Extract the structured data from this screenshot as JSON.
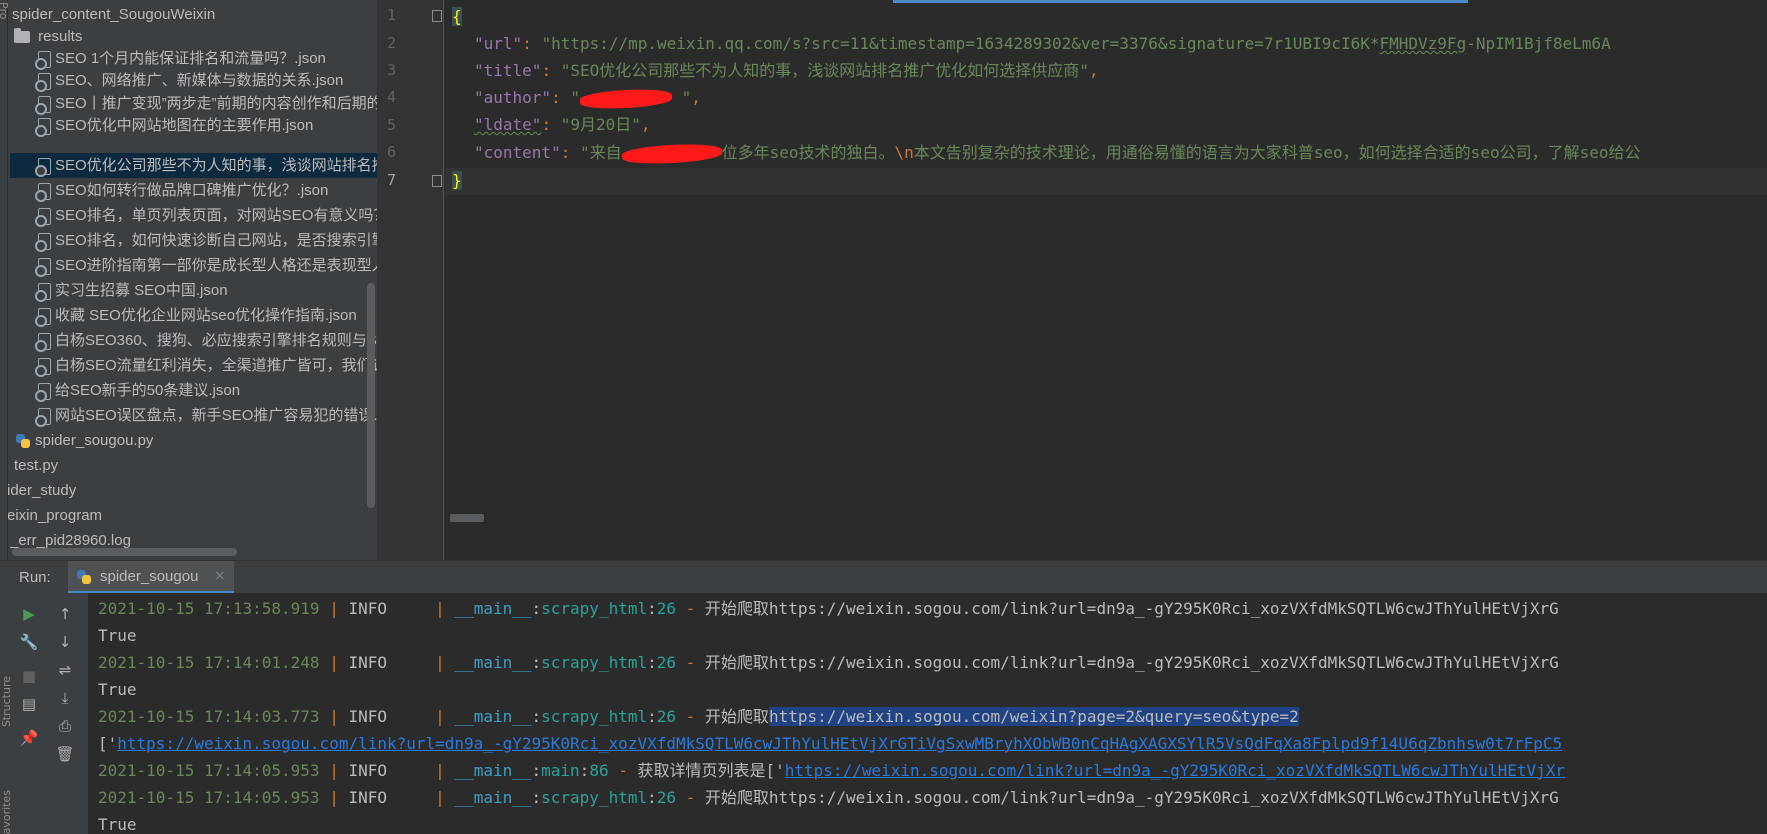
{
  "project_tree": {
    "root": "spider_content_SougouWeixin",
    "folder": "results",
    "files": [
      "SEO  1个月内能保证排名和流量吗？.json",
      "SEO、网络推广、新媒体与数据的关系.json",
      "SEO丨推广变现”两步走”前期的内容创作和后期的",
      "SEO优化中网站地图在的主要作用.json",
      "SEO优化公司那些不为人知的事，浅谈网站排名推",
      "SEO如何转行做品牌口碑推广优化？.json",
      "SEO排名，单页列表页面，对网站SEO有意义吗？",
      "SEO排名，如何快速诊断自己网站，是否搜索引擎",
      "SEO进阶指南第一部你是成长型人格还是表现型人",
      "实习生招募 SEO中国.json",
      "收藏  SEO优化企业网站seo优化操作指南.json",
      "白杨SEO360、搜狗、必应搜索引擎排名规则与S",
      "白杨SEO流量红利消失，全渠道推广皆可，我们该",
      "给SEO新手的50条建议.json",
      "网站SEO误区盘点，新手SEO推广容易犯的错误.js"
    ],
    "py_file": "spider_sougou.py",
    "test_file": "test.py",
    "other_items": [
      "ider_study",
      "eixin_program",
      "_err_pid28960.log"
    ]
  },
  "editor": {
    "line_numbers": [
      "1",
      "2",
      "3",
      "4",
      "5",
      "6",
      "7"
    ],
    "open_brace": "{",
    "close_brace": "}",
    "url_key": "\"url\"",
    "url_value_a": "\"https://mp.weixin.qq.com/s?src=11&timestamp=1634289302&ver=3376&signature=7r1UBI9cI6K*",
    "url_value_b": "FMHDVz9Fg",
    "url_value_c": "-NpIM1Bjf8eLm6A",
    "title_key": "\"title\"",
    "title_value": "\"SEO优化公司那些不为人知的事，浅谈网站排名推广优化如何选择供应商\"",
    "author_key": "\"author\"",
    "author_value_open": "\"",
    "author_value_close": " \"",
    "ldate_key": "\"ldate\"",
    "ldate_value": "\"9月20日\"",
    "content_key": "\"content\"",
    "content_value_a": "\"来自",
    "content_value_b": "位多年seo技术的独白。",
    "content_escape": "\\n",
    "content_value_c": "本文告别复杂的技术理论，用通俗易懂的语言为大家科普seo，如何选择合适的seo公司，了解seo给公",
    "colon": ": ",
    "comma": ","
  },
  "run_panel": {
    "label": "Run:",
    "tab_label": "spider_sougou",
    "tab_close": "×",
    "side_text": "Structure",
    "side_text_2": "Favorites",
    "top_text": "Pro",
    "lines": [
      {
        "time": "2021-10-15 17:13:58.919",
        "level": "INFO    ",
        "module": "__main__",
        "func": "scrapy_html",
        "lineno": "26",
        "msg": "开始爬取https://weixin.sogou.com/link?url=dn9a_-gY295K0Rci_xozVXfdMkSQTLW6cwJThYulHEtVjXrG"
      },
      {
        "plain": "True"
      },
      {
        "time": "2021-10-15 17:14:01.248",
        "level": "INFO    ",
        "module": "__main__",
        "func": "scrapy_html",
        "lineno": "26",
        "msg": "开始爬取https://weixin.sogou.com/link?url=dn9a_-gY295K0Rci_xozVXfdMkSQTLW6cwJThYulHEtVjXrG"
      },
      {
        "plain": "True"
      },
      {
        "time": "2021-10-15 17:14:03.773",
        "level": "INFO    ",
        "module": "__main__",
        "func": "scrapy_html",
        "lineno": "26",
        "msg_prefix": "开始爬取",
        "msg_selected": "https://weixin.sogou.com/weixin?page=2&query=seo&type=2"
      },
      {
        "list_open": "['",
        "link": "https://weixin.sogou.com/link?url=dn9a_-gY295K0Rci_xozVXfdMkSQTLW6cwJThYulHEtVjXrGTiVgSxwMBryhXObWB0nCqHAgXAGXSYlR5VsQdFqXa8Fplpd9f14U6qZbnhsw0t7rFpC5"
      },
      {
        "time": "2021-10-15 17:14:05.953",
        "level": "INFO    ",
        "module": "__main__",
        "func": "main",
        "lineno": "86",
        "msg_prefix": "获取详情页列表是['",
        "link": "https://weixin.sogou.com/link?url=dn9a_-gY295K0Rci_xozVXfdMkSQTLW6cwJThYulHEtVjXr"
      },
      {
        "time": "2021-10-15 17:14:05.953",
        "level": "INFO    ",
        "module": "__main__",
        "func": "scrapy_html",
        "lineno": "26",
        "msg": "开始爬取https://weixin.sogou.com/link?url=dn9a_-gY295K0Rci_xozVXfdMkSQTLW6cwJThYulHEtVjXrG"
      },
      {
        "plain": "True"
      }
    ],
    "sep": " | ",
    "dash": " - ",
    "colon": ":"
  },
  "colors": {
    "background": "#2b2b2b",
    "panel": "#3c3f41",
    "selection": "#0d293e",
    "string": "#6a8759",
    "key": "#9876aa",
    "keyword": "#cc7832",
    "link": "#287bde",
    "accent": "#4a88c7"
  }
}
